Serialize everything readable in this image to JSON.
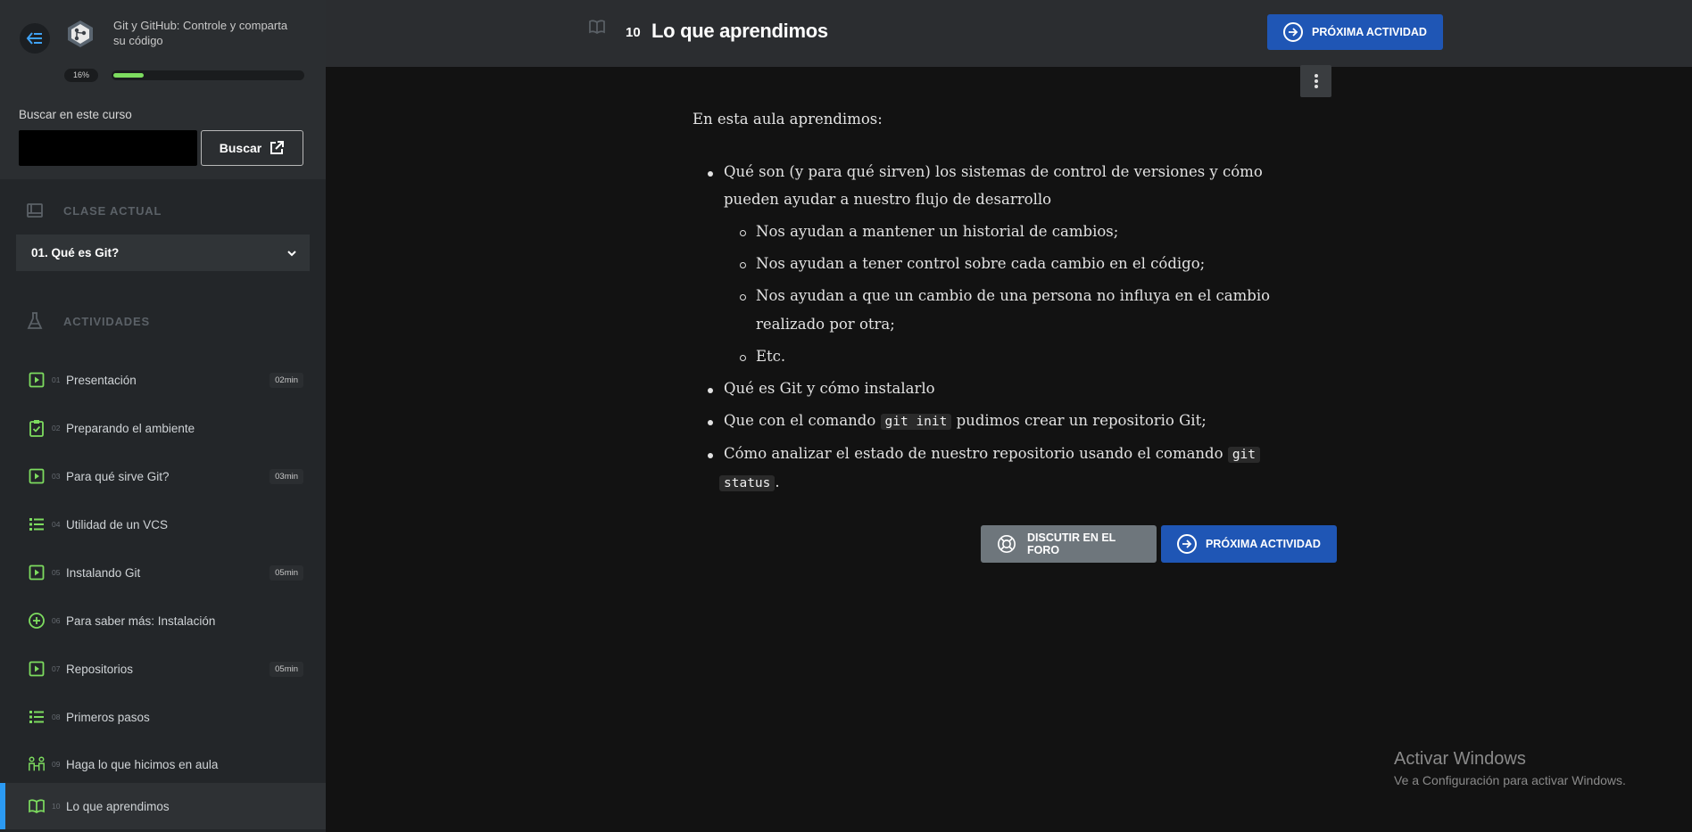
{
  "course": {
    "title": "Git y GitHub: Controle y comparta su código",
    "progress_label": "16%",
    "progress": 0.16
  },
  "search": {
    "label": "Buscar en este curso",
    "value": "",
    "button_label": "Buscar"
  },
  "sidebar": {
    "current_class_heading": "CLASE ACTUAL",
    "current_class": "01. Qué es Git?",
    "activities_heading": "ACTIVIDADES",
    "activities": [
      {
        "num": "01",
        "label": "Presentación",
        "duration": "02min",
        "icon": "video-icon"
      },
      {
        "num": "02",
        "label": "Preparando el ambiente",
        "duration": "",
        "icon": "clipboard-check-icon"
      },
      {
        "num": "03",
        "label": "Para qué sirve Git?",
        "duration": "03min",
        "icon": "video-icon"
      },
      {
        "num": "04",
        "label": "Utilidad de un VCS",
        "duration": "",
        "icon": "list-icon"
      },
      {
        "num": "05",
        "label": "Instalando Git",
        "duration": "05min",
        "icon": "video-icon"
      },
      {
        "num": "06",
        "label": "Para saber más: Instalación",
        "duration": "",
        "icon": "plus-circle-icon"
      },
      {
        "num": "07",
        "label": "Repositorios",
        "duration": "05min",
        "icon": "video-icon"
      },
      {
        "num": "08",
        "label": "Primeros pasos",
        "duration": "",
        "icon": "list-icon"
      },
      {
        "num": "09",
        "label": "Haga lo que hicimos en aula",
        "duration": "",
        "icon": "people-icon"
      },
      {
        "num": "10",
        "label": "Lo que aprendimos",
        "duration": "",
        "icon": "book-icon"
      }
    ]
  },
  "header": {
    "number": "10",
    "title": "Lo que aprendimos",
    "next_label": "PRÓXIMA ACTIVIDAD"
  },
  "content": {
    "intro": "En esta aula aprendimos:",
    "b1_line1": "Qué son (y para qué sirven) los sistemas de control de versiones y cómo",
    "b1_line2": "pueden ayudar a nuestro flujo de desarrollo",
    "s1": "Nos ayudan a mantener un historial de cambios;",
    "s2": "Nos ayudan a tener control sobre cada cambio en el código;",
    "s3_line1": "Nos ayudan a que un cambio de una persona no influya en el cambio",
    "s3_line2": "realizado por otra;",
    "s4": "Etc.",
    "b2": "Qué es Git y cómo instalarlo",
    "b3_pre": "Que con el comando",
    "b3_code": "git init",
    "b3_post": "pudimos crear un repositorio Git;",
    "b4_pre": "Cómo analizar el estado de nuestro repositorio usando el comando",
    "b4_code1": "git",
    "b4_code2": "status",
    "b4_post": "."
  },
  "footer_buttons": {
    "forum_label": "DISCUTIR EN EL FORO",
    "next_label": "PRÓXIMA ACTIVIDAD"
  },
  "watermark": {
    "title": "Activar Windows",
    "subtitle": "Ve a Configuración para activar Windows."
  },
  "colors": {
    "accent": "#1f56b5",
    "progress": "#7ddc5f",
    "active_indicator": "#2b9af3",
    "icon_green": "#7ddc5f"
  }
}
